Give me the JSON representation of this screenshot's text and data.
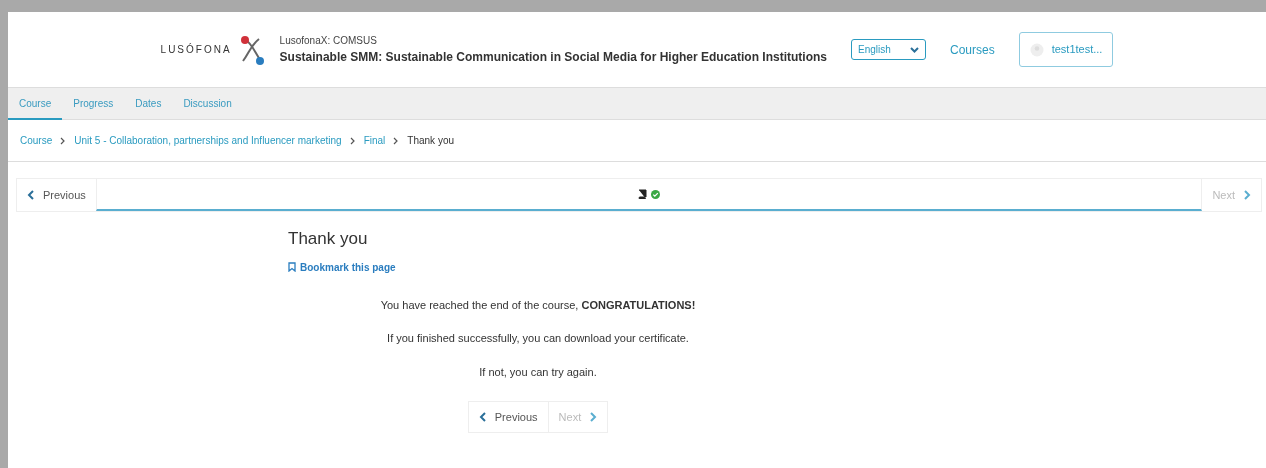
{
  "header": {
    "logo_text": "LUSÓFONA",
    "org": "LusofonaX: COMSUS",
    "course_title": "Sustainable SMM: Sustainable Communication in Social Media for Higher Education Institutions",
    "language": "English",
    "courses_link": "Courses",
    "user": "test1test..."
  },
  "tabs": [
    {
      "label": "Course",
      "selected": true
    },
    {
      "label": "Progress",
      "selected": false
    },
    {
      "label": "Dates",
      "selected": false
    },
    {
      "label": "Discussion",
      "selected": false
    }
  ],
  "breadcrumb": [
    {
      "label": "Course",
      "kind": "link"
    },
    {
      "label": "Unit 5 - Collaboration, partnerships and Influencer marketing",
      "kind": "link"
    },
    {
      "label": "Final",
      "kind": "link"
    },
    {
      "label": "Thank you",
      "kind": "current"
    }
  ],
  "sequence_nav": {
    "previous": {
      "label": "Previous",
      "disabled": false
    },
    "next": {
      "label": "Next",
      "disabled": true
    },
    "units": [
      {
        "completed": true,
        "selected": true
      }
    ]
  },
  "content": {
    "title": "Thank you",
    "bookmark": "Bookmark this page",
    "paragraphs": [
      "You have reached the end of the course, **CONGRATULATIONS!**",
      "If you finished successfully, you can download your certificate.",
      "If not, you can try again."
    ]
  },
  "bottom_nav": {
    "previous": {
      "label": "Previous",
      "disabled": false
    },
    "next": {
      "label": "Next",
      "disabled": true
    }
  }
}
